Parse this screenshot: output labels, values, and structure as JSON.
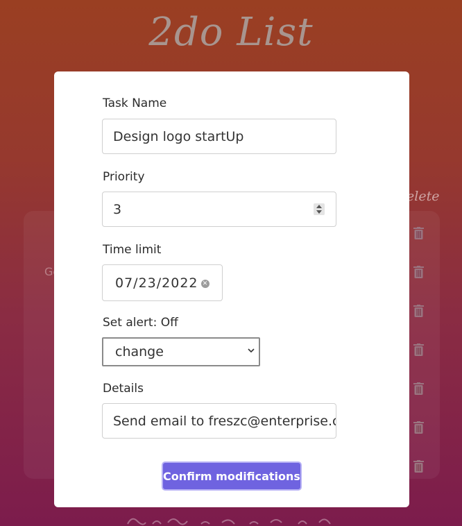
{
  "app": {
    "title": "2do List"
  },
  "background": {
    "delete_header": "elete",
    "task_fragment": "Ge"
  },
  "modal": {
    "task_name": {
      "label": "Task Name",
      "value": "Design logo startUp"
    },
    "priority": {
      "label": "Priority",
      "value": "3"
    },
    "time_limit": {
      "label": "Time limit",
      "value": "07/23/2022"
    },
    "alert": {
      "label": "Set alert: Off",
      "selected": "change"
    },
    "details": {
      "label": "Details",
      "value": "Send email to freszc@enterprise.c"
    },
    "confirm_label": "Confirm modifications"
  },
  "icons": {
    "trash": "trash-icon",
    "clear": "clear-icon",
    "chevron": "chevron-down-icon",
    "spinner": "number-spinner"
  },
  "colors": {
    "accent": "#6f63e0",
    "background_top": "#9a3f22",
    "background_bottom": "#7c1c4c"
  }
}
